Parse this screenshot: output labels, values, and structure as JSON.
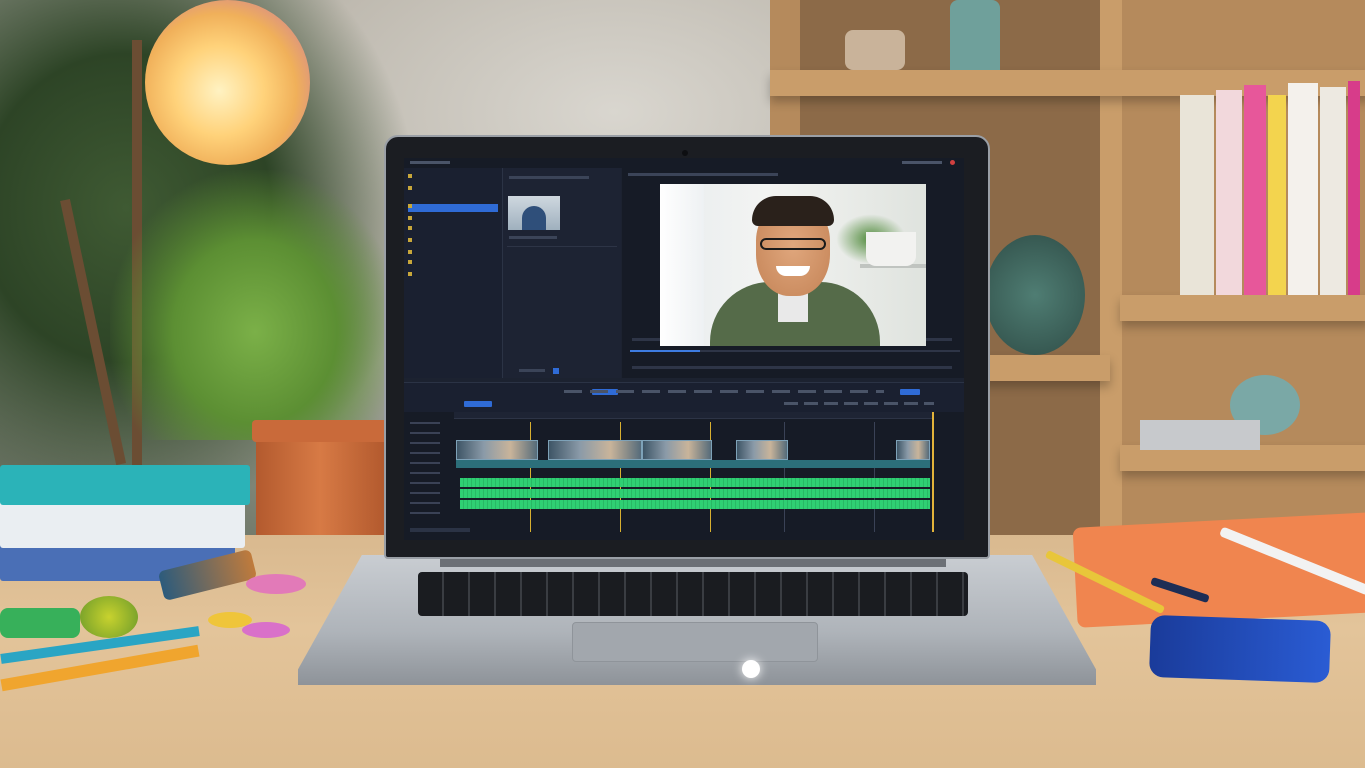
{
  "scene": {
    "description_colors": {
      "desk": "#e3c49a",
      "laptop_bezel": "#1b1d22",
      "editor_accent": "#2f6bd6",
      "audio_track": "#2fcf73",
      "playhead": "#e2b33a",
      "notebook_right": "#f0854f",
      "phone": "#2a5cd4"
    }
  },
  "editor": {
    "sidebar_icons": [
      "folder-icon",
      "media-icon",
      "audio-icon",
      "text-icon",
      "effects-icon",
      "transitions-icon",
      "elements-icon",
      "settings-icon"
    ],
    "track_icons": [
      "video-track-icon",
      "video-track-icon",
      "video-track-icon",
      "video-track-icon",
      "audio-track-icon",
      "audio-track-icon",
      "audio-track-icon"
    ]
  }
}
